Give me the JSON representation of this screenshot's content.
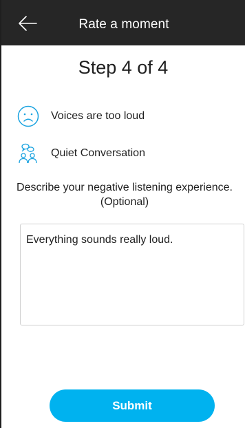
{
  "app_bar": {
    "title": "Rate a moment",
    "back_icon": "arrow-left-icon"
  },
  "step": {
    "title": "Step 4 of 4"
  },
  "moment": {
    "feeling": {
      "icon": "sad-face-icon",
      "label": "Voices are too loud"
    },
    "situation": {
      "icon": "conversation-people-icon",
      "label": "Quiet Conversation"
    }
  },
  "describe": {
    "prompt": "Describe your negative listening experience.",
    "optional": "(Optional)"
  },
  "comment": {
    "value": "Everything sounds really loud."
  },
  "submit": {
    "label": "Submit"
  },
  "colors": {
    "app_bar": "#262626",
    "accent": "#00b2ef",
    "icon_blue": "#1aa3e0"
  }
}
